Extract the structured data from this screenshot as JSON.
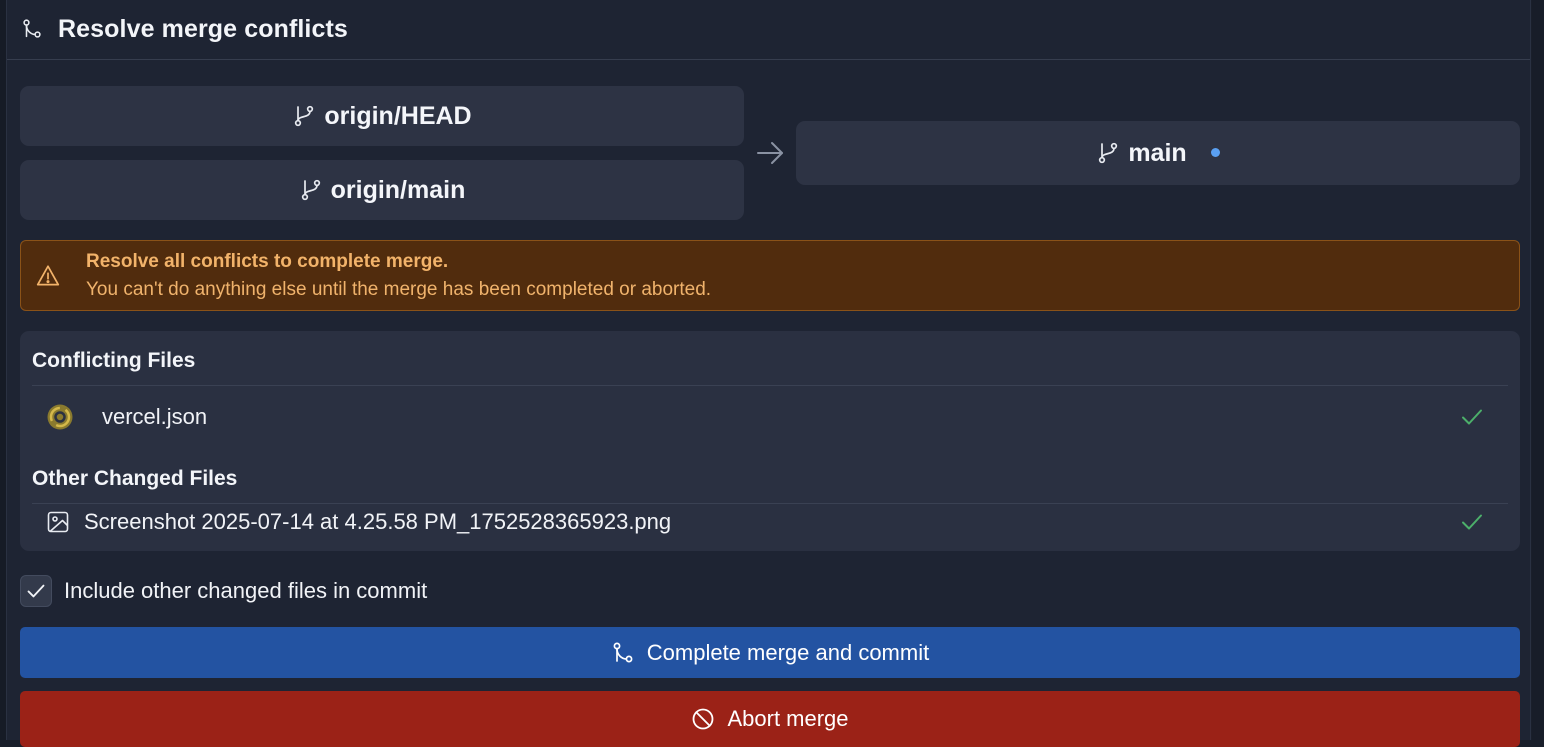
{
  "header": {
    "title": "Resolve merge conflicts",
    "icon": "merge-icon"
  },
  "sources": [
    {
      "label": "origin/HEAD",
      "icon": "git-branch-icon"
    },
    {
      "label": "origin/main",
      "icon": "git-branch-icon"
    }
  ],
  "target": {
    "label": "main",
    "icon": "git-branch-icon",
    "indicator_color": "#5aa0f2"
  },
  "warning": {
    "title": "Resolve all conflicts to complete merge.",
    "text": "You can't do anything else until the merge has been completed or aborted."
  },
  "conflicting": {
    "title": "Conflicting Files",
    "files": [
      {
        "name": "vercel.json",
        "icon": "vercel-json-icon",
        "status": "resolved"
      }
    ]
  },
  "other": {
    "title": "Other Changed Files",
    "files": [
      {
        "name": "Screenshot 2025-07-14 at 4.25.58 PM_1752528365923.png",
        "icon": "image-icon",
        "status": "resolved"
      }
    ]
  },
  "include_other": {
    "label": "Include other changed files in commit",
    "checked": true
  },
  "buttons": {
    "complete": "Complete merge and commit",
    "abort": "Abort merge"
  },
  "colors": {
    "primary": "#2353a2",
    "danger": "#9b2217",
    "warning_bg": "#512c0d",
    "warning_text": "#f2b36a",
    "check": "#4caf6a"
  }
}
